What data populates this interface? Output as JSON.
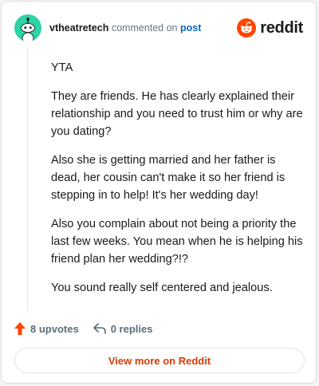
{
  "comment": {
    "username": "vtheatretech",
    "action_text": "commented on",
    "post_link": "post",
    "paragraphs": [
      "YTA",
      "They are friends. He has clearly explained their relationship and you need to trust him or why are you dating?",
      "Also she is getting married and her father is dead, her cousin can't make it so her friend is stepping in to help! It's her wedding day!",
      "Also you complain about not being a priority the last few weeks. You mean when he is helping his friend plan her wedding?!?",
      "You sound really self centered and jealous."
    ]
  },
  "brand": {
    "wordmark": "reddit",
    "icon": "reddit-snoo-icon",
    "color": "#ff4500"
  },
  "actions": {
    "upvotes": "8 upvotes",
    "replies": "0 replies",
    "upvote_icon": "upvote-arrow-icon",
    "reply_icon": "reply-arrow-icon",
    "upvote_color": "#ff4500"
  },
  "footer": {
    "view_more": "View more on Reddit",
    "link_color": "#d93a00"
  },
  "avatar": {
    "icon": "snoo-avatar-icon",
    "color": "#2ed3a8"
  }
}
